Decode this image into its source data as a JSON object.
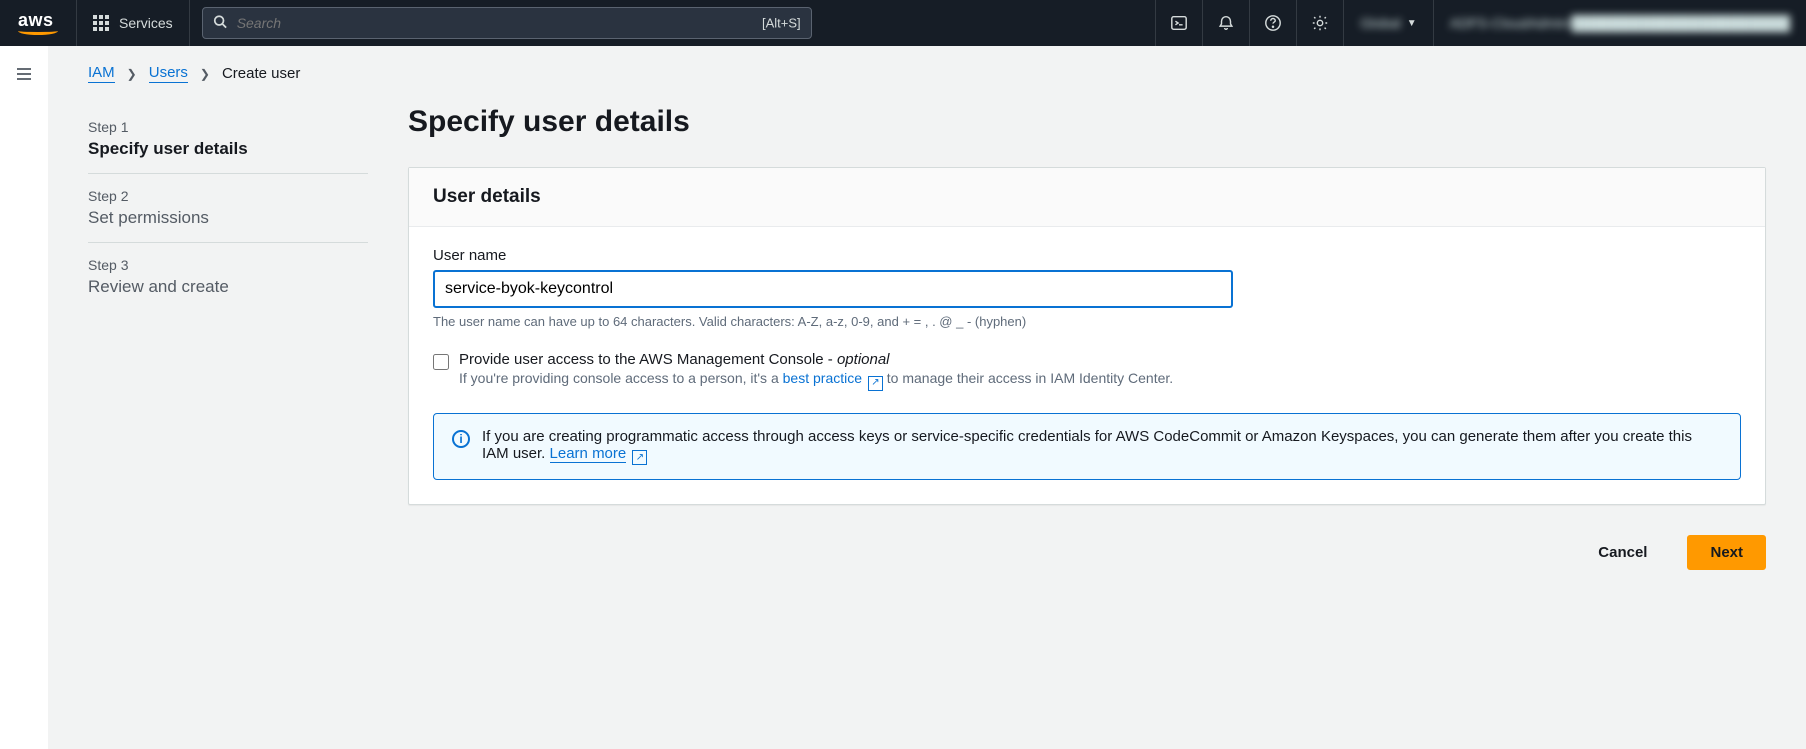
{
  "topnav": {
    "logo_text": "aws",
    "services_label": "Services",
    "search_placeholder": "Search",
    "search_shortcut": "[Alt+S]",
    "region_label": "Global",
    "account_label": "ADFS-CloudAdmin/██████████████████████"
  },
  "breadcrumb": {
    "items": [
      {
        "label": "IAM",
        "link": true
      },
      {
        "label": "Users",
        "link": true
      },
      {
        "label": "Create user",
        "link": false
      }
    ]
  },
  "steps": [
    {
      "num": "Step 1",
      "title": "Specify user details",
      "active": true
    },
    {
      "num": "Step 2",
      "title": "Set permissions",
      "active": false
    },
    {
      "num": "Step 3",
      "title": "Review and create",
      "active": false
    }
  ],
  "page": {
    "heading": "Specify user details",
    "panel_title": "User details",
    "username_label": "User name",
    "username_value": "service-byok-keycontrol",
    "username_hint": "The user name can have up to 64 characters. Valid characters: A-Z, a-z, 0-9, and + = , . @ _ - (hyphen)",
    "console_access_label": "Provide user access to the AWS Management Console - ",
    "console_access_optional": "optional",
    "console_access_sub_pre": "If you're providing console access to a person, it's a ",
    "console_access_sub_link": "best practice",
    "console_access_sub_post": " to manage their access in IAM Identity Center.",
    "infobox_text": "If you are creating programmatic access through access keys or service-specific credentials for AWS CodeCommit or Amazon Keyspaces, you can generate them after you create this IAM user. ",
    "infobox_link": "Learn more"
  },
  "actions": {
    "cancel": "Cancel",
    "next": "Next"
  }
}
